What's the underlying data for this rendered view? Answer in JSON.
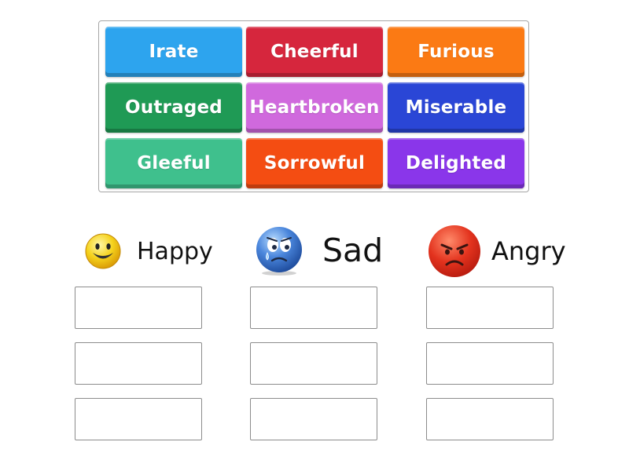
{
  "tiles": [
    {
      "label": "Irate",
      "color": "#2da4ee"
    },
    {
      "label": "Cheerful",
      "color": "#d6263d"
    },
    {
      "label": "Furious",
      "color": "#fb7a14"
    },
    {
      "label": "Outraged",
      "color": "#1f9a55"
    },
    {
      "label": "Heartbroken",
      "color": "#d069dd"
    },
    {
      "label": "Miserable",
      "color": "#2a46d6"
    },
    {
      "label": "Gleeful",
      "color": "#3fc08d"
    },
    {
      "label": "Sorrowful",
      "color": "#f44d12"
    },
    {
      "label": "Delighted",
      "color": "#8a36ea"
    }
  ],
  "categories": [
    {
      "label": "Happy",
      "icon": "happy-smiley-icon"
    },
    {
      "label": "Sad",
      "icon": "sad-face-icon"
    },
    {
      "label": "Angry",
      "icon": "angry-face-icon"
    }
  ]
}
